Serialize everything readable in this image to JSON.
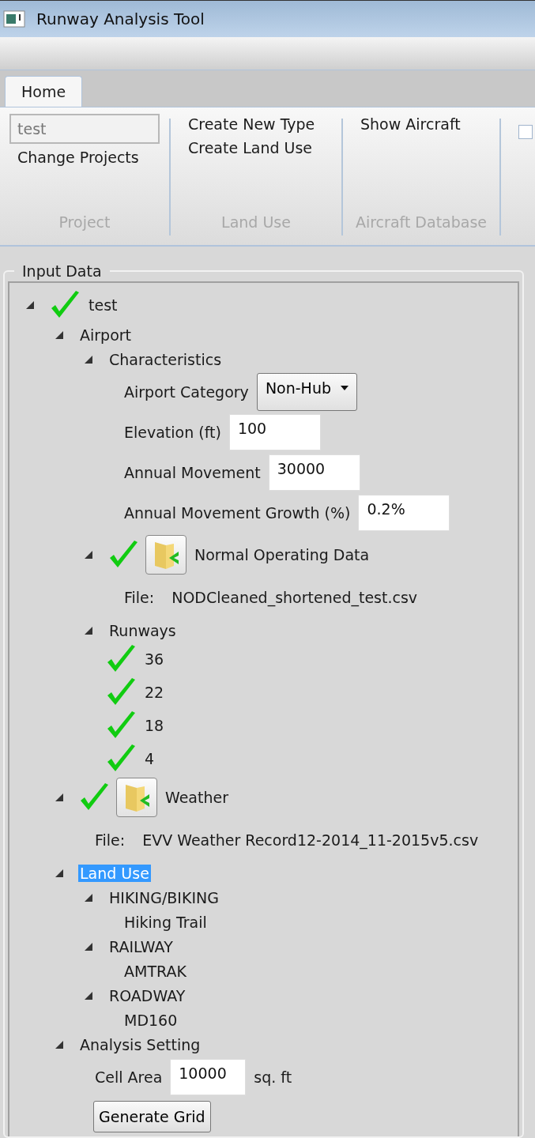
{
  "window": {
    "title": "Runway Analysis Tool"
  },
  "tabs": [
    {
      "label": "Home",
      "selected": true
    }
  ],
  "ribbon": {
    "groups": [
      {
        "name": "Project",
        "items": [
          {
            "kind": "field",
            "value": "test",
            "disabled": true
          },
          {
            "kind": "button",
            "label": "Change Projects"
          }
        ]
      },
      {
        "name": "Land Use",
        "items": [
          {
            "kind": "button",
            "label": "Create New Type"
          },
          {
            "kind": "button",
            "label": "Create Land Use"
          }
        ]
      },
      {
        "name": "Aircraft Database",
        "items": [
          {
            "kind": "button",
            "label": "Show Aircraft"
          }
        ]
      }
    ],
    "overflow_checkbox": {
      "checked": false
    }
  },
  "input_data": {
    "title": "Input Data",
    "tree": [
      {
        "kind": "node",
        "label": "test",
        "expanded": true,
        "checked": true,
        "selected": false,
        "children": [
          {
            "kind": "node",
            "label": "Airport",
            "expanded": true,
            "selected": false,
            "children": [
              {
                "kind": "node",
                "label": "Characteristics",
                "expanded": true,
                "selected": false,
                "children": [
                  {
                    "kind": "dropdown",
                    "label": "Airport Category",
                    "value": "Non-Hub"
                  },
                  {
                    "kind": "field",
                    "label": "Elevation (ft)",
                    "value": "100"
                  },
                  {
                    "kind": "field",
                    "label": "Annual Movement",
                    "value": "30000"
                  },
                  {
                    "kind": "field",
                    "label": "Annual Movement Growth (%)",
                    "value": "0.2%"
                  }
                ]
              },
              {
                "kind": "node",
                "label": "Normal Operating Data",
                "expanded": true,
                "checked": true,
                "import": true,
                "selected": false,
                "children": [
                  {
                    "kind": "file",
                    "prefix": "File:",
                    "value": "NODCleaned_shortened_test.csv"
                  }
                ]
              },
              {
                "kind": "node",
                "label": "Runways",
                "expanded": true,
                "selected": false,
                "children": [
                  {
                    "kind": "leaf",
                    "label": "36",
                    "checked": true,
                    "selected": false
                  },
                  {
                    "kind": "leaf",
                    "label": "22",
                    "checked": true,
                    "selected": false
                  },
                  {
                    "kind": "leaf",
                    "label": "18",
                    "checked": true,
                    "selected": false
                  },
                  {
                    "kind": "leaf",
                    "label": "4",
                    "checked": true,
                    "selected": false
                  }
                ]
              }
            ]
          },
          {
            "kind": "node",
            "label": "Weather",
            "expanded": true,
            "checked": true,
            "import": true,
            "selected": false,
            "children": [
              {
                "kind": "file",
                "prefix": "File:",
                "value": "EVV Weather Record12-2014_11-2015v5.csv"
              }
            ]
          },
          {
            "kind": "node",
            "label": "Land Use",
            "expanded": true,
            "selected": true,
            "children": [
              {
                "kind": "node",
                "label": "HIKING/BIKING",
                "expanded": true,
                "selected": false,
                "children": [
                  {
                    "kind": "leaf",
                    "label": "Hiking Trail",
                    "selected": false
                  }
                ]
              },
              {
                "kind": "node",
                "label": "RAILWAY",
                "expanded": true,
                "selected": false,
                "children": [
                  {
                    "kind": "leaf",
                    "label": "AMTRAK",
                    "selected": false
                  }
                ]
              },
              {
                "kind": "node",
                "label": "ROADWAY",
                "expanded": true,
                "selected": false,
                "children": [
                  {
                    "kind": "leaf",
                    "label": "MD160",
                    "selected": false
                  }
                ]
              }
            ]
          },
          {
            "kind": "node",
            "label": "Analysis Setting",
            "expanded": true,
            "selected": false,
            "children": [
              {
                "kind": "field",
                "label": "Cell Area",
                "value": "10000",
                "unit": "sq. ft"
              },
              {
                "kind": "button",
                "label": "Generate Grid"
              }
            ]
          }
        ]
      }
    ]
  }
}
